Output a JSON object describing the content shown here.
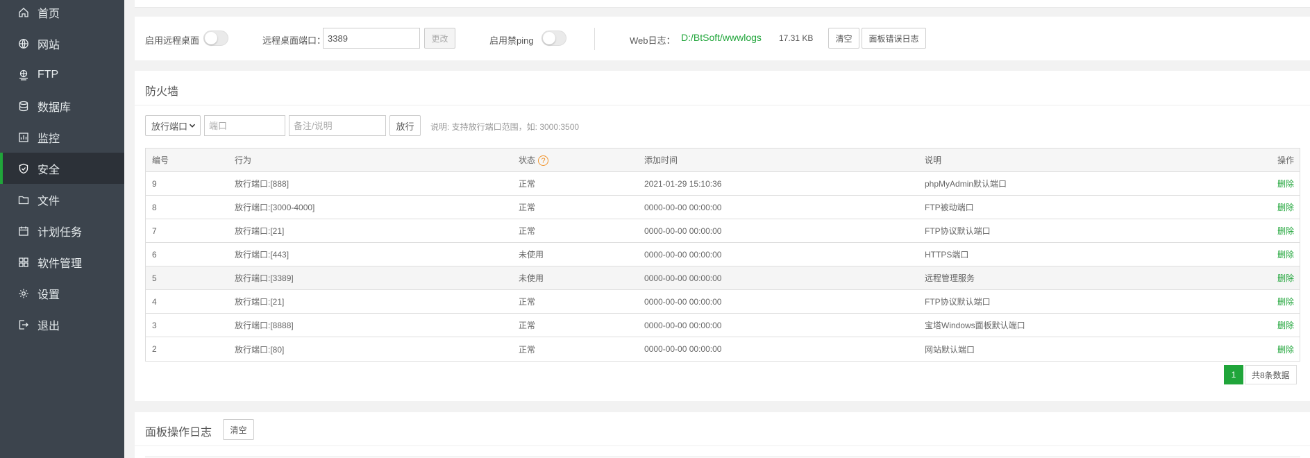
{
  "sidebar": {
    "items": [
      {
        "label": "首页",
        "icon": "home-icon",
        "active": false
      },
      {
        "label": "网站",
        "icon": "globe-icon",
        "active": false
      },
      {
        "label": "FTP",
        "icon": "ftp-icon",
        "active": false
      },
      {
        "label": "数据库",
        "icon": "database-icon",
        "active": false
      },
      {
        "label": "监控",
        "icon": "monitor-icon",
        "active": false
      },
      {
        "label": "安全",
        "icon": "shield-icon",
        "active": true
      },
      {
        "label": "文件",
        "icon": "folder-icon",
        "active": false
      },
      {
        "label": "计划任务",
        "icon": "calendar-icon",
        "active": false
      },
      {
        "label": "软件管理",
        "icon": "grid-icon",
        "active": false
      },
      {
        "label": "设置",
        "icon": "gear-icon",
        "active": false
      },
      {
        "label": "退出",
        "icon": "logout-icon",
        "active": false
      }
    ],
    "accent": "#20a53a"
  },
  "settings_bar": {
    "remote_desktop_label": "启用远程桌面",
    "remote_port_label": "远程桌面端口：",
    "remote_port_value": "3389",
    "change_button": "更改",
    "ping_label": "启用禁ping",
    "web_log_label": "Web日志：",
    "web_log_path": "D:/BtSoft/wwwlogs",
    "web_log_size": "17.31 KB",
    "clear_button": "清空",
    "panel_error_log_button": "面板错误日志"
  },
  "firewall": {
    "title": "防火墙",
    "select_value": "放行端口",
    "port_placeholder": "端口",
    "note_placeholder": "备注/说明",
    "allow_button": "放行",
    "hint": "说明: 支持放行端口范围，如: 3000:3500",
    "columns": [
      "编号",
      "行为",
      "状态",
      "添加时间",
      "说明",
      "操作"
    ],
    "rows": [
      {
        "id": "9",
        "action": "放行端口:[888]",
        "status": "正常",
        "time": "2021-01-29 15:10:36",
        "note": "phpMyAdmin默认端口",
        "op": "删除"
      },
      {
        "id": "8",
        "action": "放行端口:[3000-4000]",
        "status": "正常",
        "time": "0000-00-00 00:00:00",
        "note": "FTP被动端口",
        "op": "删除"
      },
      {
        "id": "7",
        "action": "放行端口:[21]",
        "status": "正常",
        "time": "0000-00-00 00:00:00",
        "note": "FTP协议默认端口",
        "op": "删除"
      },
      {
        "id": "6",
        "action": "放行端口:[443]",
        "status": "未使用",
        "time": "0000-00-00 00:00:00",
        "note": "HTTPS端口",
        "op": "删除"
      },
      {
        "id": "5",
        "action": "放行端口:[3389]",
        "status": "未使用",
        "time": "0000-00-00 00:00:00",
        "note": "远程管理服务",
        "op": "删除"
      },
      {
        "id": "4",
        "action": "放行端口:[21]",
        "status": "正常",
        "time": "0000-00-00 00:00:00",
        "note": "FTP协议默认端口",
        "op": "删除"
      },
      {
        "id": "3",
        "action": "放行端口:[8888]",
        "status": "正常",
        "time": "0000-00-00 00:00:00",
        "note": "宝塔Windows面板默认端口",
        "op": "删除"
      },
      {
        "id": "2",
        "action": "放行端口:[80]",
        "status": "正常",
        "time": "0000-00-00 00:00:00",
        "note": "网站默认端口",
        "op": "删除"
      }
    ],
    "pager": {
      "current": "1",
      "total_text": "共8条数据"
    }
  },
  "panel_log": {
    "title": "面板操作日志",
    "clear_button": "清空"
  }
}
